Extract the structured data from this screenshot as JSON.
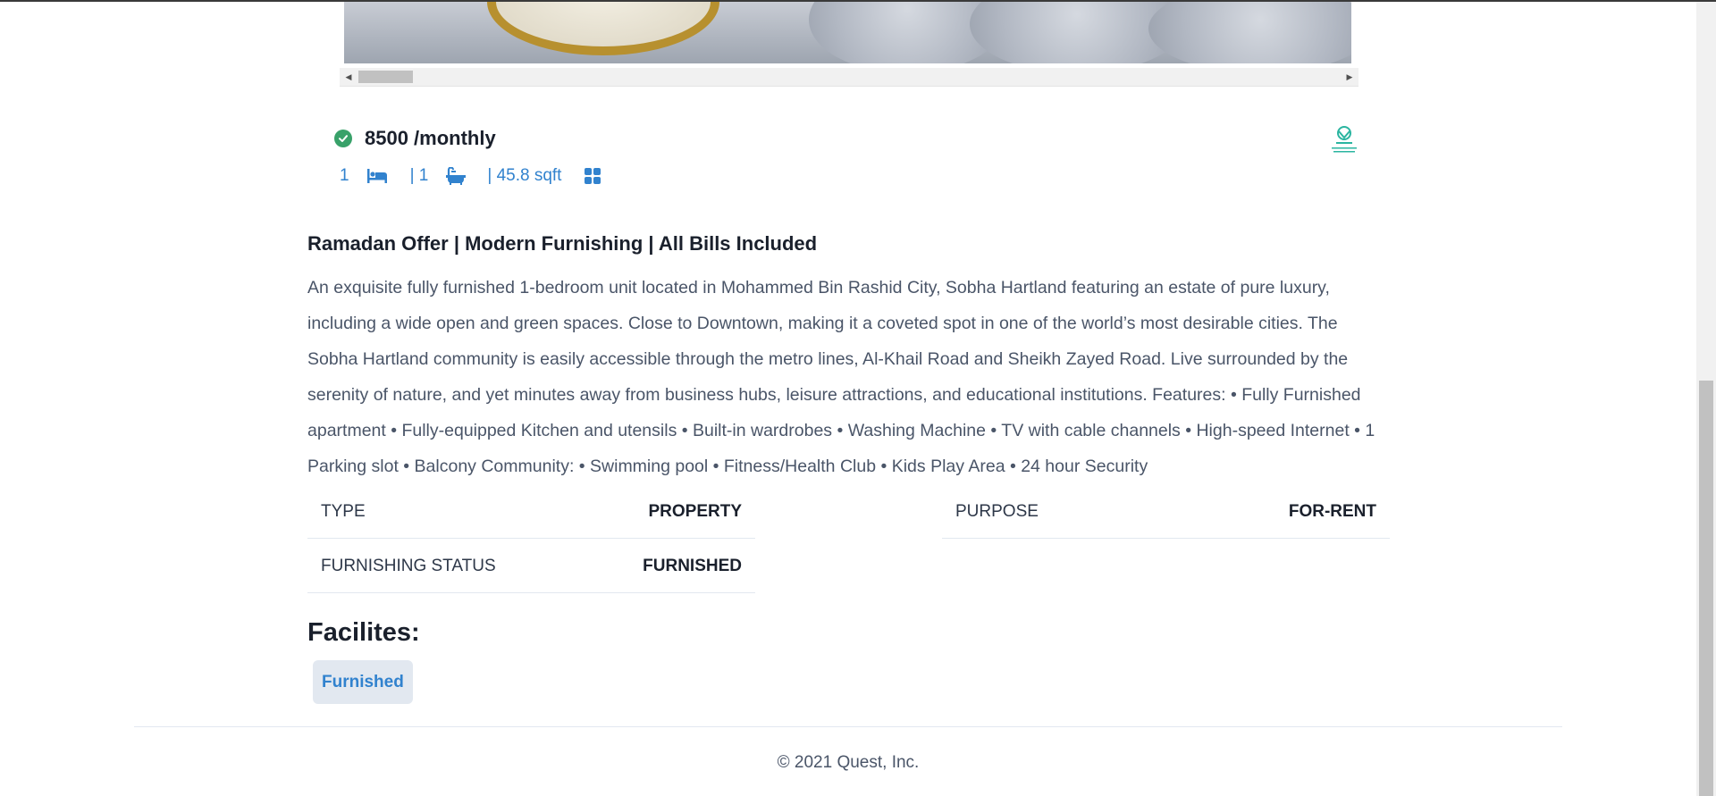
{
  "listing": {
    "price": "8500 /monthly",
    "rooms": "1",
    "baths": "| 1",
    "area": "| 45.8 sqft",
    "title": "Ramadan Offer | Modern Furnishing | All Bills Included",
    "description": "An exquisite fully furnished 1-bedroom unit located in Mohammed Bin Rashid City, Sobha Hartland featuring an estate of pure luxury, including a wide open and green spaces. Close to Downtown, making it a coveted spot in one of the world’s most desirable cities. The Sobha Hartland community is easily accessible through the metro lines, Al-Khail Road and Sheikh Zayed Road. Live surrounded by the serenity of nature, and yet minutes away from business hubs, leisure attractions, and educational institutions. Features: • Fully Furnished apartment • Fully-equipped Kitchen and utensils • Built-in wardrobes • Washing Machine • TV with cable channels • High-speed Internet • 1 Parking slot • Balcony Community: • Swimming pool • Fitness/Health Club • Kids Play Area • 24 hour Security"
  },
  "details": [
    {
      "label": "TYPE",
      "value": "PROPERTY"
    },
    {
      "label": "PURPOSE",
      "value": "FOR-RENT"
    },
    {
      "label": "FURNISHING STATUS",
      "value": "FURNISHED"
    }
  ],
  "facilities": {
    "heading": "Facilites:",
    "items": [
      "Furnished"
    ]
  },
  "footer": {
    "copyright": "© 2021 Quest, Inc."
  },
  "icons": {
    "verified": "verified-check-icon",
    "bed": "bed-icon",
    "bath": "bath-icon",
    "area": "grid-area-icon",
    "agency": "agency-logo-icon"
  },
  "colors": {
    "accent_blue": "#3182ce",
    "verified_green": "#38a169",
    "badge_bg": "#e2e8f0",
    "agency_teal": "#2bb5a0"
  }
}
